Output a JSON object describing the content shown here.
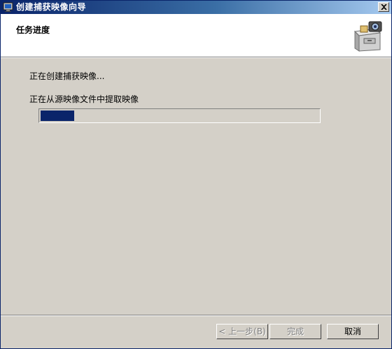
{
  "window": {
    "title": "创建捕获映像向导",
    "close_icon": "close-icon",
    "app_icon": "monitor-icon"
  },
  "header": {
    "heading": "任务进度",
    "icon": "file-cabinet-camera-icon"
  },
  "content": {
    "status_line": "正在创建捕获映像...",
    "task_text": "正在从源映像文件中提取映像",
    "progress_fraction": 0.12
  },
  "buttons": {
    "back_label": "< 上一步(B)",
    "finish_label": "完成",
    "cancel_label": "取消"
  },
  "colors": {
    "titlebar_start": "#0a246a",
    "titlebar_end": "#a6caf0",
    "progress_fill": "#0a246a",
    "dialog_bg": "#d4d0c8"
  }
}
